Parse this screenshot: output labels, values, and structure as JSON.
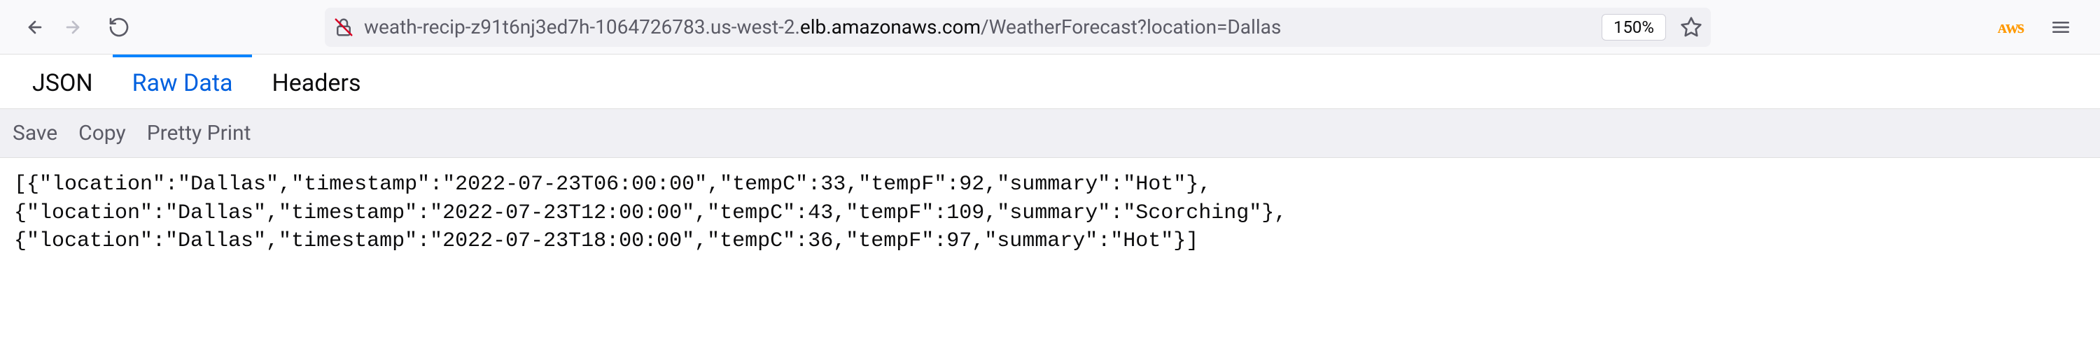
{
  "toolbar": {
    "url_prefix": "weath-recip-z91t6nj3ed7h-1064726783.us-west-2.",
    "url_host": "elb.amazonaws.com",
    "url_path": "/WeatherForecast?location=Dallas",
    "zoom": "150%"
  },
  "tabs": {
    "json": "JSON",
    "raw_data": "Raw Data",
    "headers": "Headers"
  },
  "actions": {
    "save": "Save",
    "copy": "Copy",
    "pretty_print": "Pretty Print"
  },
  "raw_response": "[{\"location\":\"Dallas\",\"timestamp\":\"2022-07-23T06:00:00\",\"tempC\":33,\"tempF\":92,\"summary\":\"Hot\"},\n{\"location\":\"Dallas\",\"timestamp\":\"2022-07-23T12:00:00\",\"tempC\":43,\"tempF\":109,\"summary\":\"Scorching\"},\n{\"location\":\"Dallas\",\"timestamp\":\"2022-07-23T18:00:00\",\"tempC\":36,\"tempF\":97,\"summary\":\"Hot\"}]"
}
